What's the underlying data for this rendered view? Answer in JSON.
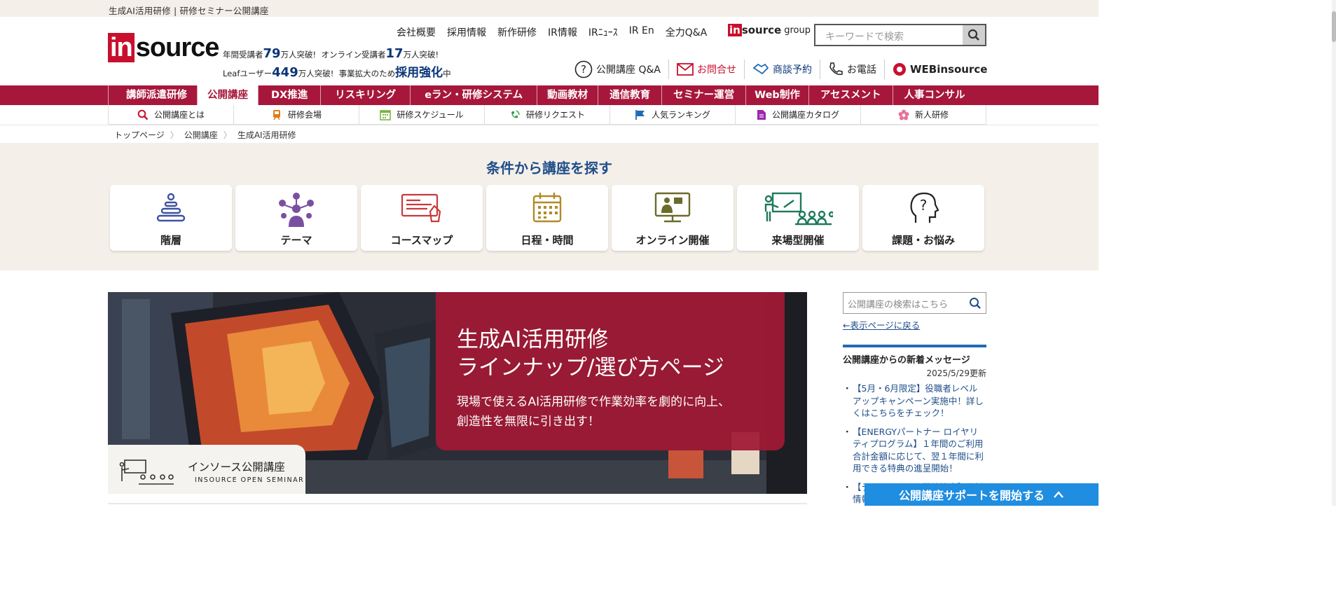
{
  "topbar": {
    "text": "生成AI活用研修 | 研修セミナー公開講座"
  },
  "logo": {
    "part1": "in",
    "part2": "source"
  },
  "stats": {
    "l1a": "年間受講者",
    "l1b": "79",
    "l1c": "万人突破!",
    "l1d": "オンライン受講者",
    "l1e": "17",
    "l1f": "万人突破!",
    "l2a": "Leafユーザー",
    "l2b": "449",
    "l2c": "万人突破!",
    "l2d": "事業拡大のため",
    "l2e": "採用強化",
    "l2f": "中"
  },
  "topnav": [
    "会社概要",
    "採用情報",
    "新作研修",
    "IR情報",
    "IRﾆｭｰｽ",
    "IR En",
    "全力Q&A"
  ],
  "group": {
    "in": "in",
    "src": "source",
    "label": "group"
  },
  "search": {
    "placeholder": "キーワードで検索"
  },
  "util": {
    "qa": "公開講座 Q&A",
    "contact": "お問合せ",
    "meeting": "商談予約",
    "phone": "お電話",
    "web": "WEBinsource"
  },
  "mainnav": [
    "講師派遣研修",
    "公開講座",
    "DX推進",
    "リスキリング",
    "eラン・研修システム",
    "動画教材",
    "通信教育",
    "セミナー運営",
    "Web制作",
    "アセスメント",
    "人事コンサル"
  ],
  "subnav": [
    "公開講座とは",
    "研修会場",
    "研修スケジュール",
    "研修リクエスト",
    "人気ランキング",
    "公開講座カタログ",
    "新人研修"
  ],
  "breadcrumb": [
    "トップページ",
    "公開講座",
    "生成AI活用研修"
  ],
  "finder": {
    "title": "条件から講座を探す",
    "cards": [
      "階層",
      "テーマ",
      "コースマップ",
      "日程・時間",
      "オンライン開催",
      "来場型開催",
      "課題・お悩み"
    ]
  },
  "hero": {
    "title1": "生成AI活用研修",
    "title2": "ラインナップ/選び方ページ",
    "desc1": "現場で使えるAI活用研修で作業効率を劇的に向上、",
    "desc2": "創造性を無限に引き出す！",
    "tag_jp": "インソース公開講座",
    "tag_en": "INSOURCE OPEN SEMINAR"
  },
  "sidebar": {
    "search_placeholder": "公開講座の検索はこちら",
    "back": "←表示ページに戻る",
    "news_title": "公開講座からの新着メッセージ",
    "news_date": "2025/5/29更新",
    "news": [
      "【5月・6月限定】役職者レベルアップキャンペーン実施中！詳しくはこちらをチェック！",
      "【ENERGYパートナー ロイヤリティプログラム】１年間のご利用合計金額に応じて、翌１年間に利用できる特典の進呈開始！",
      "【テーマ・コース開催決定】最新情報"
    ]
  },
  "support": {
    "label": "公開講座サポートを開始する"
  },
  "colors": {
    "brand_red": "#c8102e",
    "nav_red": "#a7173c",
    "navy": "#1f4e89",
    "support_blue": "#1f8de0"
  }
}
